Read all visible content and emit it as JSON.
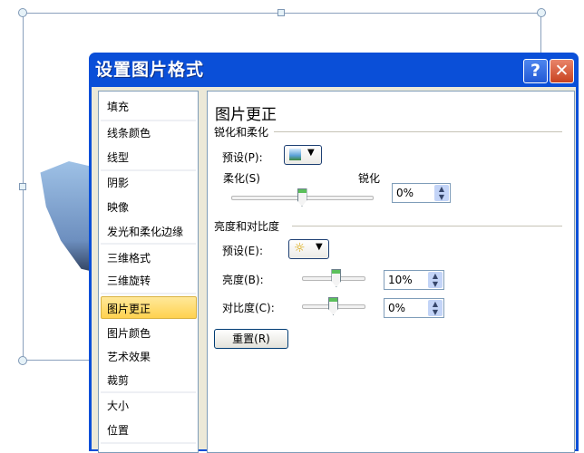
{
  "dialog": {
    "title": "设置图片格式",
    "help_icon": "?",
    "close_icon": "✕"
  },
  "sidebar": {
    "items": [
      {
        "label": "填充"
      },
      {
        "label": "线条颜色"
      },
      {
        "label": "线型"
      },
      {
        "label": "阴影"
      },
      {
        "label": "映像"
      },
      {
        "label": "发光和柔化边缘"
      },
      {
        "label": "三维格式"
      },
      {
        "label": "三维旋转"
      },
      {
        "label": "图片更正",
        "selected": true
      },
      {
        "label": "图片颜色"
      },
      {
        "label": "艺术效果"
      },
      {
        "label": "裁剪"
      },
      {
        "label": "大小"
      },
      {
        "label": "位置"
      }
    ]
  },
  "panel": {
    "title": "图片更正",
    "sharpen": {
      "heading": "锐化和柔化",
      "preset_label": "预设(P):",
      "soften_label": "柔化(S)",
      "sharpen_label": "锐化",
      "value": "0%",
      "slider_percent": 50
    },
    "brightness": {
      "heading": "亮度和对比度",
      "preset_label": "预设(E):",
      "brightness_label": "亮度(B):",
      "brightness_value": "10%",
      "brightness_slider_percent": 55,
      "contrast_label": "对比度(C):",
      "contrast_value": "0%",
      "contrast_slider_percent": 50
    },
    "reset_label": "重置(R)"
  }
}
